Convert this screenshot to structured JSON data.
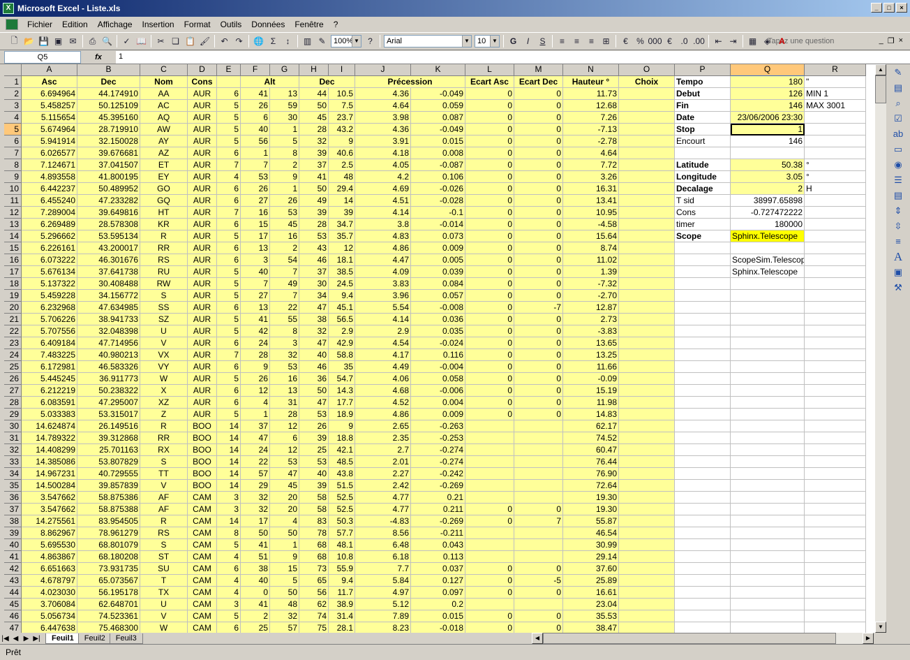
{
  "window": {
    "title": "Microsoft Excel - Liste.xls"
  },
  "menu": [
    "Fichier",
    "Edition",
    "Affichage",
    "Insertion",
    "Format",
    "Outils",
    "Données",
    "Fenêtre",
    "?"
  ],
  "question_placeholder": "Tapez une question",
  "toolbar": {
    "zoom": "100%",
    "font": "Arial",
    "size": "10"
  },
  "formula": {
    "namebox": "Q5",
    "fx": "fx",
    "value": "1"
  },
  "columns": [
    "A",
    "B",
    "C",
    "D",
    "E",
    "F",
    "G",
    "H",
    "I",
    "J",
    "K",
    "L",
    "M",
    "N",
    "O",
    "P",
    "Q",
    "R"
  ],
  "selected_col": "Q",
  "selected_row": 5,
  "header_row": {
    "A": "Asc",
    "B": "Dec",
    "C": "Nom",
    "D": "Cons",
    "F": "Alt",
    "H": "Dec",
    "J": "Précession",
    "L": "Ecart Asc",
    "M": "Ecart Dec",
    "N": "Hauteur °",
    "O": "Choix"
  },
  "rows": [
    [
      "6.694964",
      "44.174910",
      "AA",
      "AUR",
      "6",
      "41",
      "13",
      "44",
      "10.5",
      "4.36",
      "-0.049",
      "0",
      "0",
      "11.73"
    ],
    [
      "5.458257",
      "50.125109",
      "AC",
      "AUR",
      "5",
      "26",
      "59",
      "50",
      "7.5",
      "4.64",
      "0.059",
      "0",
      "0",
      "12.68"
    ],
    [
      "5.115654",
      "45.395160",
      "AQ",
      "AUR",
      "5",
      "6",
      "30",
      "45",
      "23.7",
      "3.98",
      "0.087",
      "0",
      "0",
      "7.26"
    ],
    [
      "5.674964",
      "28.719910",
      "AW",
      "AUR",
      "5",
      "40",
      "1",
      "28",
      "43.2",
      "4.36",
      "-0.049",
      "0",
      "0",
      "-7.13"
    ],
    [
      "5.941914",
      "32.150028",
      "AY",
      "AUR",
      "5",
      "56",
      "5",
      "32",
      "9",
      "3.91",
      "0.015",
      "0",
      "0",
      "-2.78"
    ],
    [
      "6.026577",
      "39.676681",
      "AZ",
      "AUR",
      "6",
      "1",
      "8",
      "39",
      "40.6",
      "4.18",
      "0.008",
      "0",
      "0",
      "4.64"
    ],
    [
      "7.124671",
      "37.041507",
      "ET",
      "AUR",
      "7",
      "7",
      "2",
      "37",
      "2.5",
      "4.05",
      "-0.087",
      "0",
      "0",
      "7.72"
    ],
    [
      "4.893558",
      "41.800195",
      "EY",
      "AUR",
      "4",
      "53",
      "9",
      "41",
      "48",
      "4.2",
      "0.106",
      "0",
      "0",
      "3.26"
    ],
    [
      "6.442237",
      "50.489952",
      "GO",
      "AUR",
      "6",
      "26",
      "1",
      "50",
      "29.4",
      "4.69",
      "-0.026",
      "0",
      "0",
      "16.31"
    ],
    [
      "6.455240",
      "47.233282",
      "GQ",
      "AUR",
      "6",
      "27",
      "26",
      "49",
      "14",
      "4.51",
      "-0.028",
      "0",
      "0",
      "13.41"
    ],
    [
      "7.289004",
      "39.649816",
      "HT",
      "AUR",
      "7",
      "16",
      "53",
      "39",
      "39",
      "4.14",
      "-0.1",
      "0",
      "0",
      "10.95"
    ],
    [
      "6.269489",
      "28.578308",
      "KR",
      "AUR",
      "6",
      "15",
      "45",
      "28",
      "34.7",
      "3.8",
      "-0.014",
      "0",
      "0",
      "-4.58"
    ],
    [
      "5.296662",
      "53.595134",
      "R",
      "AUR",
      "5",
      "17",
      "16",
      "53",
      "35.7",
      "4.83",
      "0.073",
      "0",
      "0",
      "15.64"
    ],
    [
      "6.226161",
      "43.200017",
      "RR",
      "AUR",
      "6",
      "13",
      "2",
      "43",
      "12",
      "4.86",
      "0.009",
      "0",
      "0",
      "8.74"
    ],
    [
      "6.073222",
      "46.301676",
      "RS",
      "AUR",
      "6",
      "3",
      "54",
      "46",
      "18.1",
      "4.47",
      "0.005",
      "0",
      "0",
      "11.02"
    ],
    [
      "5.676134",
      "37.641738",
      "RU",
      "AUR",
      "5",
      "40",
      "7",
      "37",
      "38.5",
      "4.09",
      "0.039",
      "0",
      "0",
      "1.39"
    ],
    [
      "5.137322",
      "30.408488",
      "RW",
      "AUR",
      "5",
      "7",
      "49",
      "30",
      "24.5",
      "3.83",
      "0.084",
      "0",
      "0",
      "-7.32"
    ],
    [
      "5.459228",
      "34.156772",
      "S",
      "AUR",
      "5",
      "27",
      "7",
      "34",
      "9.4",
      "3.96",
      "0.057",
      "0",
      "0",
      "-2.70"
    ],
    [
      "6.232968",
      "47.634985",
      "SS",
      "AUR",
      "6",
      "13",
      "22",
      "47",
      "45.1",
      "5.54",
      "-0.008",
      "0",
      "-7",
      "12.87"
    ],
    [
      "5.706226",
      "38.941733",
      "SZ",
      "AUR",
      "5",
      "41",
      "55",
      "38",
      "56.5",
      "4.14",
      "0.036",
      "0",
      "0",
      "2.73"
    ],
    [
      "5.707556",
      "32.048398",
      "U",
      "AUR",
      "5",
      "42",
      "8",
      "32",
      "2.9",
      "2.9",
      "0.035",
      "0",
      "0",
      "-3.83"
    ],
    [
      "6.409184",
      "47.714956",
      "V",
      "AUR",
      "6",
      "24",
      "3",
      "47",
      "42.9",
      "4.54",
      "-0.024",
      "0",
      "0",
      "13.65"
    ],
    [
      "7.483225",
      "40.980213",
      "VX",
      "AUR",
      "7",
      "28",
      "32",
      "40",
      "58.8",
      "4.17",
      "0.116",
      "0",
      "0",
      "13.25"
    ],
    [
      "6.172981",
      "46.583326",
      "VY",
      "AUR",
      "6",
      "9",
      "53",
      "46",
      "35",
      "4.49",
      "-0.004",
      "0",
      "0",
      "11.66"
    ],
    [
      "5.445245",
      "36.911773",
      "W",
      "AUR",
      "5",
      "26",
      "16",
      "36",
      "54.7",
      "4.06",
      "0.058",
      "0",
      "0",
      "-0.09"
    ],
    [
      "6.212219",
      "50.238322",
      "X",
      "AUR",
      "6",
      "12",
      "13",
      "50",
      "14.3",
      "4.68",
      "-0.006",
      "0",
      "0",
      "15.19"
    ],
    [
      "6.083591",
      "47.295007",
      "XZ",
      "AUR",
      "6",
      "4",
      "31",
      "47",
      "17.7",
      "4.52",
      "0.004",
      "0",
      "0",
      "11.98"
    ],
    [
      "5.033383",
      "53.315017",
      "Z",
      "AUR",
      "5",
      "1",
      "28",
      "53",
      "18.9",
      "4.86",
      "0.009",
      "0",
      "0",
      "14.83"
    ],
    [
      "14.624874",
      "26.149516",
      "R",
      "BOO",
      "14",
      "37",
      "12",
      "26",
      "9",
      "2.65",
      "-0.263",
      "",
      "",
      "62.17"
    ],
    [
      "14.789322",
      "39.312868",
      "RR",
      "BOO",
      "14",
      "47",
      "6",
      "39",
      "18.8",
      "2.35",
      "-0.253",
      "",
      "",
      "74.52"
    ],
    [
      "14.408299",
      "25.701163",
      "RX",
      "BOO",
      "14",
      "24",
      "12",
      "25",
      "42.1",
      "2.7",
      "-0.274",
      "",
      "",
      "60.47"
    ],
    [
      "14.385086",
      "53.807829",
      "S",
      "BOO",
      "14",
      "22",
      "53",
      "53",
      "48.5",
      "2.01",
      "-0.274",
      "",
      "",
      "76.44"
    ],
    [
      "14.967231",
      "40.729555",
      "TT",
      "BOO",
      "14",
      "57",
      "47",
      "40",
      "43.8",
      "2.27",
      "-0.242",
      "",
      "",
      "76.90"
    ],
    [
      "14.500284",
      "39.857839",
      "V",
      "BOO",
      "14",
      "29",
      "45",
      "39",
      "51.5",
      "2.42",
      "-0.269",
      "",
      "",
      "72.64"
    ],
    [
      "3.547662",
      "58.875386",
      "AF",
      "CAM",
      "3",
      "32",
      "20",
      "58",
      "52.5",
      "4.77",
      "0.21",
      "",
      "",
      "19.30"
    ],
    [
      "3.547662",
      "58.875388",
      "AF",
      "CAM",
      "3",
      "32",
      "20",
      "58",
      "52.5",
      "4.77",
      "0.211",
      "0",
      "0",
      "19.30"
    ],
    [
      "14.275561",
      "83.954505",
      "R",
      "CAM",
      "14",
      "17",
      "4",
      "83",
      "50.3",
      "-4.83",
      "-0.269",
      "0",
      "7",
      "55.87"
    ],
    [
      "8.862967",
      "78.961279",
      "RS",
      "CAM",
      "8",
      "50",
      "50",
      "78",
      "57.7",
      "8.56",
      "-0.211",
      "",
      "",
      "46.54"
    ],
    [
      "5.695530",
      "68.801079",
      "S",
      "CAM",
      "5",
      "41",
      "1",
      "68",
      "48.1",
      "6.48",
      "0.043",
      "",
      "",
      "30.99"
    ],
    [
      "4.863867",
      "68.180208",
      "ST",
      "CAM",
      "4",
      "51",
      "9",
      "68",
      "10.8",
      "6.18",
      "0.113",
      "",
      "",
      "29.14"
    ],
    [
      "6.651663",
      "73.931735",
      "SU",
      "CAM",
      "6",
      "38",
      "15",
      "73",
      "55.9",
      "7.7",
      "0.037",
      "0",
      "0",
      "37.60"
    ],
    [
      "4.678797",
      "65.073567",
      "T",
      "CAM",
      "4",
      "40",
      "5",
      "65",
      "9.4",
      "5.84",
      "0.127",
      "0",
      "-5",
      "25.89"
    ],
    [
      "4.023030",
      "56.195178",
      "TX",
      "CAM",
      "4",
      "0",
      "50",
      "56",
      "11.7",
      "4.97",
      "0.097",
      "0",
      "0",
      "16.61"
    ],
    [
      "3.706084",
      "62.648701",
      "U",
      "CAM",
      "3",
      "41",
      "48",
      "62",
      "38.9",
      "5.12",
      "0.2",
      "",
      "",
      "23.04"
    ],
    [
      "5.056734",
      "74.523361",
      "V",
      "CAM",
      "5",
      "2",
      "32",
      "74",
      "31.4",
      "7.89",
      "0.015",
      "0",
      "0",
      "35.53"
    ],
    [
      "6.447638",
      "75.468300",
      "W",
      "CAM",
      "6",
      "25",
      "57",
      "75",
      "28.1",
      "8.23",
      "-0.018",
      "0",
      "0",
      "38.47"
    ]
  ],
  "params": [
    {
      "row": 1,
      "P": "Tempo",
      "Q": "180",
      "R": "\"",
      "bold": true,
      "fill": "y"
    },
    {
      "row": 2,
      "P": "Debut",
      "Q": "126",
      "R": "MIN 1",
      "bold": true,
      "fill": "y"
    },
    {
      "row": 3,
      "P": "Fin",
      "Q": "146",
      "R": "MAX 3001",
      "bold": true,
      "fill": "y"
    },
    {
      "row": 4,
      "P": "Date",
      "Q": "23/06/2006 23:30",
      "R": "",
      "bold": true,
      "fill": "y"
    },
    {
      "row": 5,
      "P": "Stop",
      "Q": "1",
      "R": "",
      "bold": true,
      "fill": "y"
    },
    {
      "row": 6,
      "P": "Encourt",
      "Q": "146",
      "R": "",
      "bold": false,
      "fill": ""
    },
    {
      "row": 8,
      "P": "Latitude",
      "Q": "50.38",
      "R": "°",
      "bold": true,
      "fill": "y"
    },
    {
      "row": 9,
      "P": "Longitude",
      "Q": "3.05",
      "R": "°",
      "bold": true,
      "fill": "y"
    },
    {
      "row": 10,
      "P": "Decalage",
      "Q": "2",
      "R": "H",
      "bold": true,
      "fill": "y"
    },
    {
      "row": 11,
      "P": "T sid",
      "Q": "38997.65898",
      "R": "",
      "bold": false,
      "fill": ""
    },
    {
      "row": 12,
      "P": "Cons",
      "Q": "-0.727472222",
      "R": "",
      "bold": false,
      "fill": ""
    },
    {
      "row": 13,
      "P": "timer",
      "Q": "180000",
      "R": "",
      "bold": false,
      "fill": ""
    },
    {
      "row": 14,
      "P": "Scope",
      "Q": "Sphinx.Telescope",
      "R": "",
      "bold": true,
      "fill": "yy"
    },
    {
      "row": 16,
      "P": "",
      "Q": "ScopeSim.Telescope",
      "R": "",
      "bold": false,
      "fill": ""
    },
    {
      "row": 17,
      "P": "",
      "Q": "Sphinx.Telescope",
      "R": "",
      "bold": false,
      "fill": ""
    }
  ],
  "sheets": [
    "Feuil1",
    "Feuil2",
    "Feuil3"
  ],
  "status": "Prêt",
  "colors": {
    "fill_light_yellow": "#ffff99",
    "fill_yellow": "#ffff00",
    "selection": "#ffc87a"
  }
}
